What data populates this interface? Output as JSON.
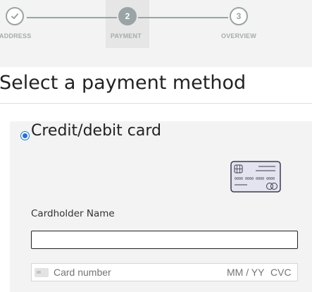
{
  "stepper": {
    "steps": [
      {
        "label": "ADDRESS",
        "marker": "",
        "state": "done",
        "icon": "check-icon"
      },
      {
        "label": "PAYMENT",
        "marker": "2",
        "state": "active"
      },
      {
        "label": "OVERVIEW",
        "marker": "3",
        "state": "pending"
      }
    ]
  },
  "page": {
    "title": "Select a payment method"
  },
  "payment_method": {
    "title": "Credit/debit card",
    "selected": true,
    "icon": "credit-card-icon",
    "cardholder_label": "Cardholder Name",
    "cardholder_value": "",
    "card_number_placeholder": "Card number",
    "expiry_placeholder": "MM / YY",
    "cvc_placeholder": "CVC"
  },
  "colors": {
    "accent": "#1a73e8",
    "stepper_bg": "#f3f3f3",
    "step_gray": "#9aa4a4",
    "panel_bg": "#f3f3f3"
  }
}
